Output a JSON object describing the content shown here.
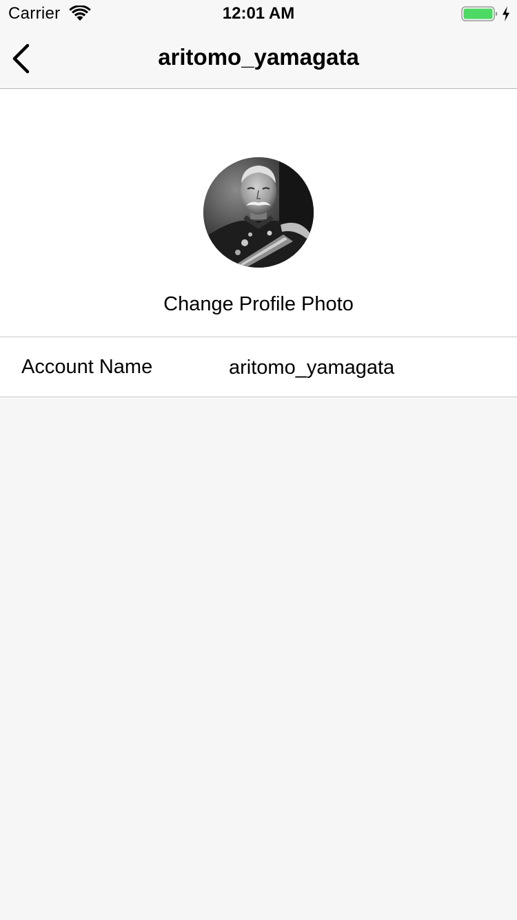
{
  "status_bar": {
    "carrier": "Carrier",
    "time": "12:01 AM",
    "battery_color": "#4cd964"
  },
  "nav": {
    "title": "aritomo_yamagata",
    "back_icon": "chevron-left-icon"
  },
  "profile": {
    "change_photo_label": "Change Profile Photo"
  },
  "account": {
    "label": "Account Name",
    "value": "aritomo_yamagata"
  }
}
